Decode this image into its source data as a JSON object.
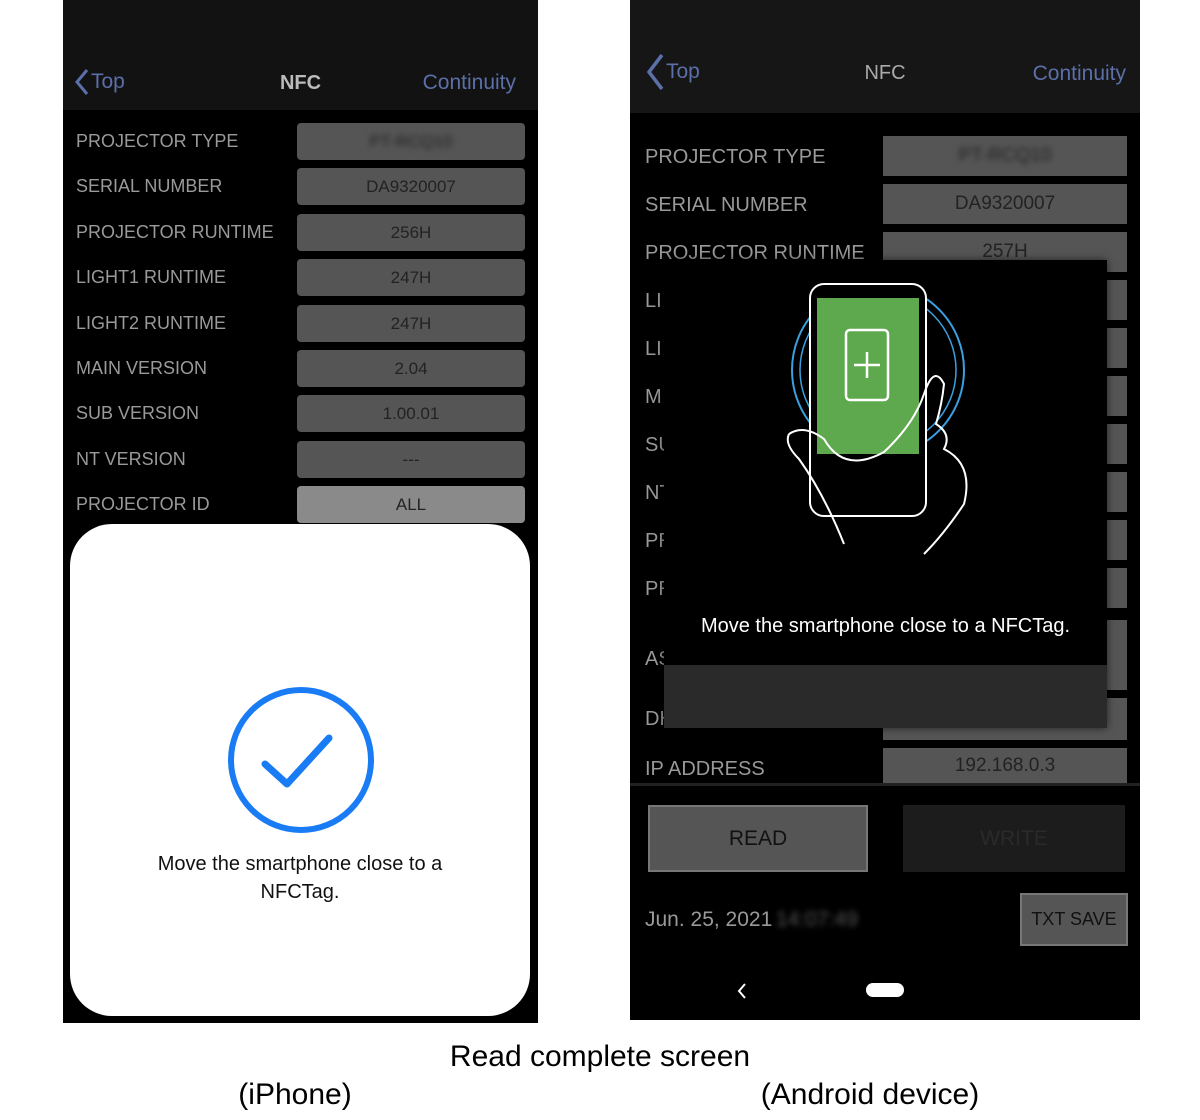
{
  "iphone": {
    "header": {
      "back": "Top",
      "title": "NFC",
      "right": "Continuity"
    },
    "rows": [
      {
        "label": "PROJECTOR TYPE",
        "value": "PT-RCQ10",
        "blurred": true
      },
      {
        "label": "SERIAL NUMBER",
        "value": "DA9320007"
      },
      {
        "label": "PROJECTOR RUNTIME",
        "value": "256H"
      },
      {
        "label": "LIGHT1 RUNTIME",
        "value": "247H"
      },
      {
        "label": "LIGHT2 RUNTIME",
        "value": "247H"
      },
      {
        "label": "MAIN VERSION",
        "value": "2.04"
      },
      {
        "label": "SUB VERSION",
        "value": "1.00.01"
      },
      {
        "label": "NT VERSION",
        "value": "---"
      },
      {
        "label": "PROJECTOR ID",
        "value": "ALL"
      }
    ],
    "dialog": {
      "icon": "checkmark-circle-icon",
      "message": "Move the smartphone close to a NFCTag.",
      "accent": "#1a7cf5"
    }
  },
  "android": {
    "header": {
      "back": "Top",
      "title": "NFC",
      "right": "Continuity"
    },
    "rows": [
      {
        "label": "PROJECTOR TYPE",
        "value": "PT-RCQ10",
        "blurred": true
      },
      {
        "label": "SERIAL NUMBER",
        "value": "DA9320007"
      },
      {
        "label": "PROJECTOR RUNTIME",
        "value": "257H"
      },
      {
        "label": "LI",
        "value": ""
      },
      {
        "label": "LI",
        "value": ""
      },
      {
        "label": "M",
        "value": ""
      },
      {
        "label": "SU",
        "value": ""
      },
      {
        "label": "NT",
        "value": ""
      },
      {
        "label": "PR",
        "value": ""
      },
      {
        "label": "PR",
        "value": ""
      },
      {
        "label": "AS",
        "value": ""
      },
      {
        "label": "DH",
        "value": ""
      },
      {
        "label": "IP ADDRESS",
        "value": "192.168.0.3"
      }
    ],
    "dialog": {
      "icon": "phone-nfc-tap-icon",
      "message": "Move the smartphone close to a NFCTag.",
      "accent": "#5ea84e"
    },
    "read_label": "READ",
    "write_label": "WRITE",
    "date": "Jun. 25, 2021",
    "time": "14:07:49",
    "txt_save_label": "TXT SAVE"
  },
  "captions": {
    "title": "Read complete screen",
    "left": "(iPhone)",
    "right": "(Android device)"
  }
}
